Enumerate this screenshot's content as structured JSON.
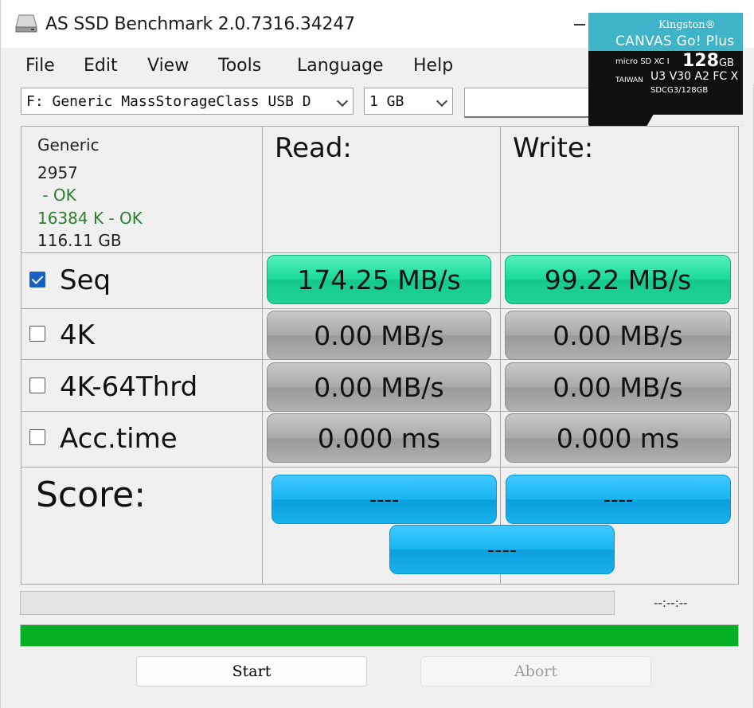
{
  "window": {
    "title": "AS SSD Benchmark 2.0.7316.34247"
  },
  "menu": [
    "File",
    "Edit",
    "View",
    "Tools",
    "Language",
    "Help"
  ],
  "drive_select": {
    "value": "F: Generic MassStorageClass USB D"
  },
  "size_select": {
    "value": "1 GB"
  },
  "drive_info": {
    "vendor": "Generic",
    "firmware": "2957",
    "driver_status": " - OK",
    "alignment": "16384 K - OK",
    "capacity": "116.11 GB",
    "ok_color": "#2e7d32"
  },
  "columns": {
    "read": "Read:",
    "write": "Write:"
  },
  "rows": [
    {
      "label": "Seq",
      "checked": true,
      "read": "174.25 MB/s",
      "write": "99.22 MB/s"
    },
    {
      "label": "4K",
      "checked": false,
      "read": "0.00 MB/s",
      "write": "0.00 MB/s"
    },
    {
      "label": "4K-64Thrd",
      "checked": false,
      "read": "0.00 MB/s",
      "write": "0.00 MB/s"
    },
    {
      "label": "Acc.time",
      "checked": false,
      "read": "0.000 ms",
      "write": "0.000 ms"
    }
  ],
  "score": {
    "label": "Score:",
    "read": "----",
    "write": "----",
    "total": "----"
  },
  "progress": {
    "elapsed": "--:--:--",
    "percent": 100,
    "fill_color": "#06b025"
  },
  "buttons": {
    "start": "Start",
    "abort": "Abort"
  },
  "card_image": {
    "brand": "Kingston®",
    "product": "CANVAS Go! Plus",
    "capacity_value": "128",
    "capacity_unit": "GB",
    "format": "micro SD XC I",
    "origin": "TAIWAN",
    "speed_marks": "U3 V30 A2 FC X",
    "model": "SDCG3/128GB"
  }
}
